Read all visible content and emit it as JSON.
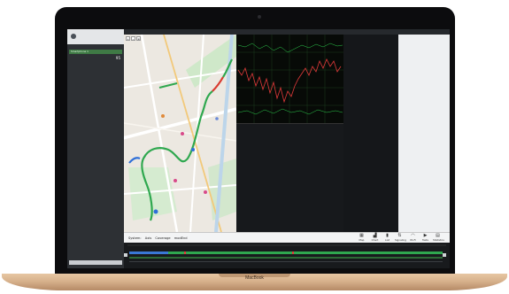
{
  "laptop": {
    "brand": "MacBook"
  },
  "left_panel": {
    "selected_device": "Smartphone 1",
    "device_value": "95"
  },
  "status_bar": {
    "system_label": "System:",
    "system_value": "Axis",
    "coverage_label": "Coverage",
    "coverage_value": "modEnd"
  },
  "toolbar": [
    {
      "label": "Map",
      "icon": "map-icon"
    },
    {
      "label": "Chart",
      "icon": "chart-icon"
    },
    {
      "label": "List",
      "icon": "list-icon"
    },
    {
      "label": "Signaling",
      "icon": "signaling-icon"
    },
    {
      "label": "Wi-Fi",
      "icon": "wifi-icon"
    },
    {
      "label": "Tests",
      "icon": "play-icon"
    },
    {
      "label": "Statistics",
      "icon": "clipboard-icon"
    }
  ],
  "colors": {
    "route_green": "#2fa84f",
    "route_blue": "#2f6fd8",
    "route_red": "#d93a2f",
    "graph_red": "#e23a3a",
    "graph_green": "#2ccd4c",
    "selected": "#3f7a45"
  }
}
